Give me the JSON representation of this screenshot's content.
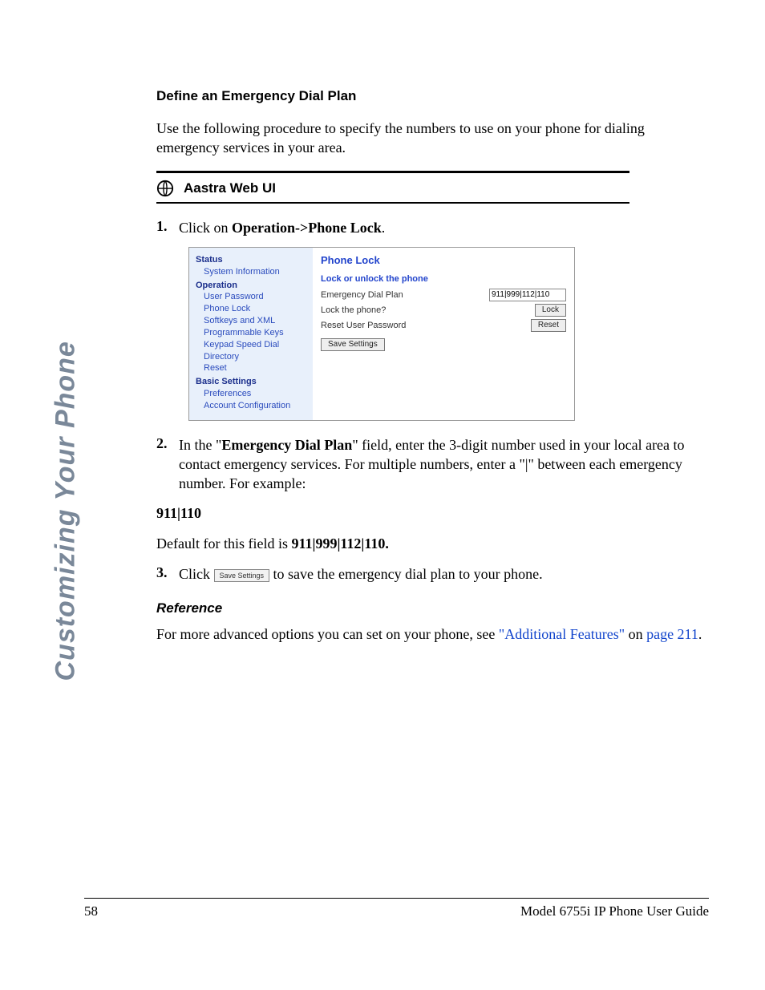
{
  "sidebar_label": "Customizing Your Phone",
  "heading": "Define an Emergency Dial Plan",
  "intro": "Use the following procedure to specify the numbers to use on your phone for dialing emergency services in your area.",
  "instr_title": "Aastra Web UI",
  "step1_prefix": "Click on ",
  "step1_bold": "Operation->Phone Lock",
  "step1_suffix": ".",
  "figure": {
    "side": {
      "status": "Status",
      "sys_info": "System Information",
      "operation": "Operation",
      "user_pw": "User Password",
      "phone_lock": "Phone Lock",
      "softkeys": "Softkeys and XML",
      "prog_keys": "Programmable Keys",
      "keypad": "Keypad Speed Dial",
      "directory": "Directory",
      "reset": "Reset",
      "basic": "Basic Settings",
      "prefs": "Preferences",
      "acct": "Account Configuration"
    },
    "main": {
      "title": "Phone Lock",
      "sub": "Lock or unlock the phone",
      "row1_label": "Emergency Dial Plan",
      "row1_value": "911|999|112|110",
      "row2_label": "Lock the phone?",
      "row2_btn": "Lock",
      "row3_label": "Reset User Password",
      "row3_btn": "Reset",
      "save_btn": "Save Settings"
    }
  },
  "step2_a": "In the \"",
  "step2_bold": "Emergency Dial Plan",
  "step2_b": "\" field, enter the 3-digit number used in your local area to contact emergency services. For multiple numbers, enter a \"|\" between each emergency number. For example:",
  "example": "911|110",
  "default_a": "Default for this field is ",
  "default_b": "911|999|112|110.",
  "step3_a": "Click ",
  "step3_btn": "Save Settings",
  "step3_b": " to save the emergency dial plan to your phone.",
  "reference_h": "Reference",
  "reference_a": "For more advanced options you can set on your phone, see ",
  "reference_link1": "\"Additional Features\"",
  "reference_mid": " on ",
  "reference_link2": "page 211",
  "reference_end": ".",
  "footer_page": "58",
  "footer_title": "Model 6755i IP Phone User Guide"
}
